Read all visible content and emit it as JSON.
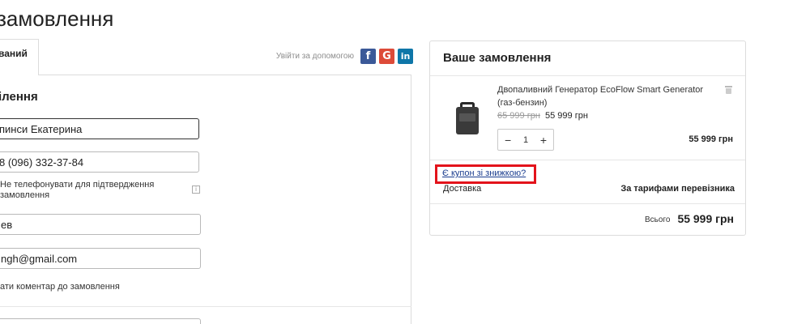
{
  "page": {
    "title": "замовлення"
  },
  "tabs": {
    "active_label": "ваний"
  },
  "help": {
    "text": "Увійти за допомогою",
    "facebook_icon": "facebook-icon",
    "google_icon": "google-icon",
    "linkedin_icon": "linkedin-icon"
  },
  "form": {
    "section_title": "ілення",
    "name_value": "пинси Екатерина",
    "phone_value": "8 (096) 332-37-84",
    "no_call_label": "Не телефонувати для підтвердження замовлення",
    "city_value": "ев",
    "email_value": "ngh@gmail.com",
    "comment_link": "ати коментар до замовлення"
  },
  "order": {
    "title": "Ваше замовлення",
    "product": {
      "name": "Двопаливний Генератор EcoFlow Smart Generator (газ-бензин)",
      "old_price": "65 999 грн",
      "price": "55 999 грн",
      "quantity": "1",
      "line_total": "55 999 грн"
    },
    "coupon_link": "Є купон зі знижкою?",
    "delivery_label": "Доставка",
    "delivery_value": "За тарифами перевізника",
    "total_label": "Всього",
    "total_value": "55 999 грн"
  },
  "colors": {
    "highlight": "#e3131b",
    "link": "#1a3d8f",
    "facebook": "#3b5998",
    "google": "#dd4b39",
    "linkedin": "#0e76a8"
  }
}
